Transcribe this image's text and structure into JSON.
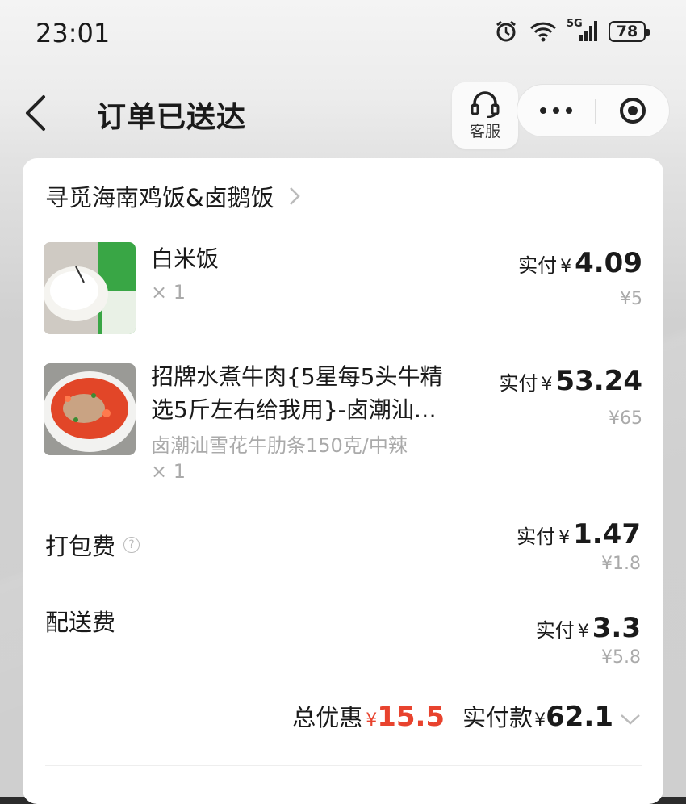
{
  "status": {
    "time": "23:01",
    "network": "5G",
    "battery": "78"
  },
  "nav": {
    "title": "订单已送达",
    "service_label": "客服"
  },
  "store": {
    "name": "寻觅海南鸡饭&卤鹅饭"
  },
  "items": [
    {
      "name": "白米饭",
      "qty": "× 1",
      "paid_label": "实付",
      "currency": "¥",
      "paid": "4.09",
      "original": "¥5"
    },
    {
      "name_line1": "招牌水煮牛肉{5星每5头牛精",
      "name_line2": "选5斤左右给我用}-卤潮汕…",
      "spec": "卤潮汕雪花牛肋条150克/中辣",
      "qty": "× 1",
      "paid_label": "实付",
      "currency": "¥",
      "paid": "53.24",
      "original": "¥65"
    }
  ],
  "fees": [
    {
      "label": "打包费",
      "help": "?",
      "paid_label": "实付",
      "currency": "¥",
      "paid": "1.47",
      "original": "¥1.8"
    },
    {
      "label": "配送费",
      "paid_label": "实付",
      "currency": "¥",
      "paid": "3.3",
      "original": "¥5.8"
    }
  ],
  "totals": {
    "discount_label": "总优惠",
    "currency": "¥",
    "discount": "15.5",
    "paid_label": "实付款",
    "paid": "62.1"
  },
  "colors": {
    "accent_red": "#e8432e"
  }
}
